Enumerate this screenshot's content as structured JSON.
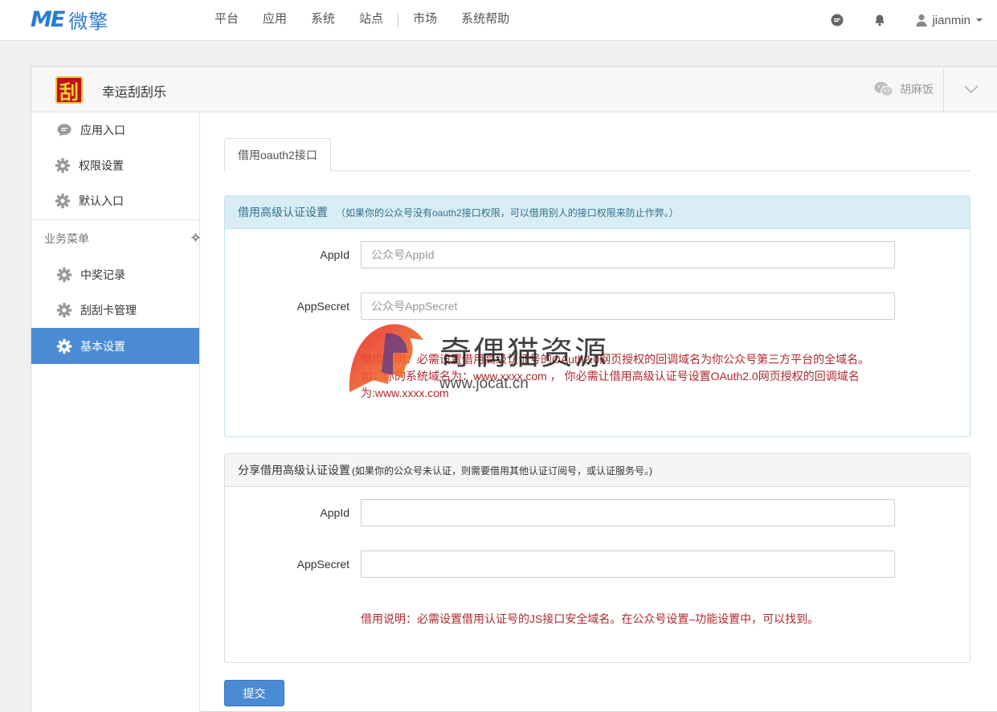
{
  "navbar": {
    "logo_mark": "ME",
    "logo_text": "微擎",
    "menu": [
      "平台",
      "应用",
      "系统",
      "站点",
      "市场",
      "系统帮助"
    ],
    "username": "jianmin",
    "icons": [
      "chat-bubble-icon",
      "bell-icon",
      "user-icon"
    ]
  },
  "app": {
    "icon_glyph": "刮",
    "name": "幸运刮刮乐",
    "account_name": "胡麻饭"
  },
  "sidebar": {
    "top_items": [
      {
        "label": "应用入口",
        "icon": "chat-icon"
      },
      {
        "label": "权限设置",
        "icon": "gear-icon"
      },
      {
        "label": "默认入口",
        "icon": "gear-icon"
      }
    ],
    "group_title": "业务菜单",
    "group_items": [
      {
        "label": "中奖记录",
        "icon": "gear-icon"
      },
      {
        "label": "刮刮卡管理",
        "icon": "gear-icon"
      },
      {
        "label": "基本设置",
        "icon": "gear-icon",
        "active": true
      }
    ]
  },
  "tabs": [
    {
      "label": "借用oauth2接口",
      "active": true
    }
  ],
  "section1": {
    "title": "借用高级认证设置",
    "note": "（如果你的公众号没有oauth2接口权限，可以借用别人的接口权限来防止作弊。）",
    "appid_label": "AppId",
    "appid_placeholder": "公众号AppId",
    "appid_value": "",
    "secret_label": "AppSecret",
    "secret_placeholder": "公众号AppSecret",
    "secret_value": "",
    "help_line1": "借用说明：必需设置借用高级认证号的OAuth2.0网页授权的回调域名为你公众号第三方平台的全域名。",
    "help_line2": "如：你的系统域名为：www.xxxx.com ， 你必需让借用高级认证号设置OAuth2.0网页授权的回调域名",
    "help_line3": "为:www.xxxx.com"
  },
  "section2": {
    "title": "分享借用高级认证设置",
    "note": "(如果你的公众号未认证，则需要借用其他认证订阅号，或认证服务号。)",
    "appid_label": "AppId",
    "appid_value": "",
    "secret_label": "AppSecret",
    "secret_value": "",
    "help": "借用说明：必需设置借用认证号的JS接口安全域名。在公众号设置–功能设置中，可以找到。"
  },
  "submit_label": "提交",
  "watermark": {
    "text": "奇偶猫资源",
    "url": "www.jocat.cn"
  },
  "colors": {
    "brand_blue": "#2b7bd6",
    "active_blue": "#4a8bd4",
    "info_bg": "#d9edf7",
    "help_red": "#b0282e"
  }
}
